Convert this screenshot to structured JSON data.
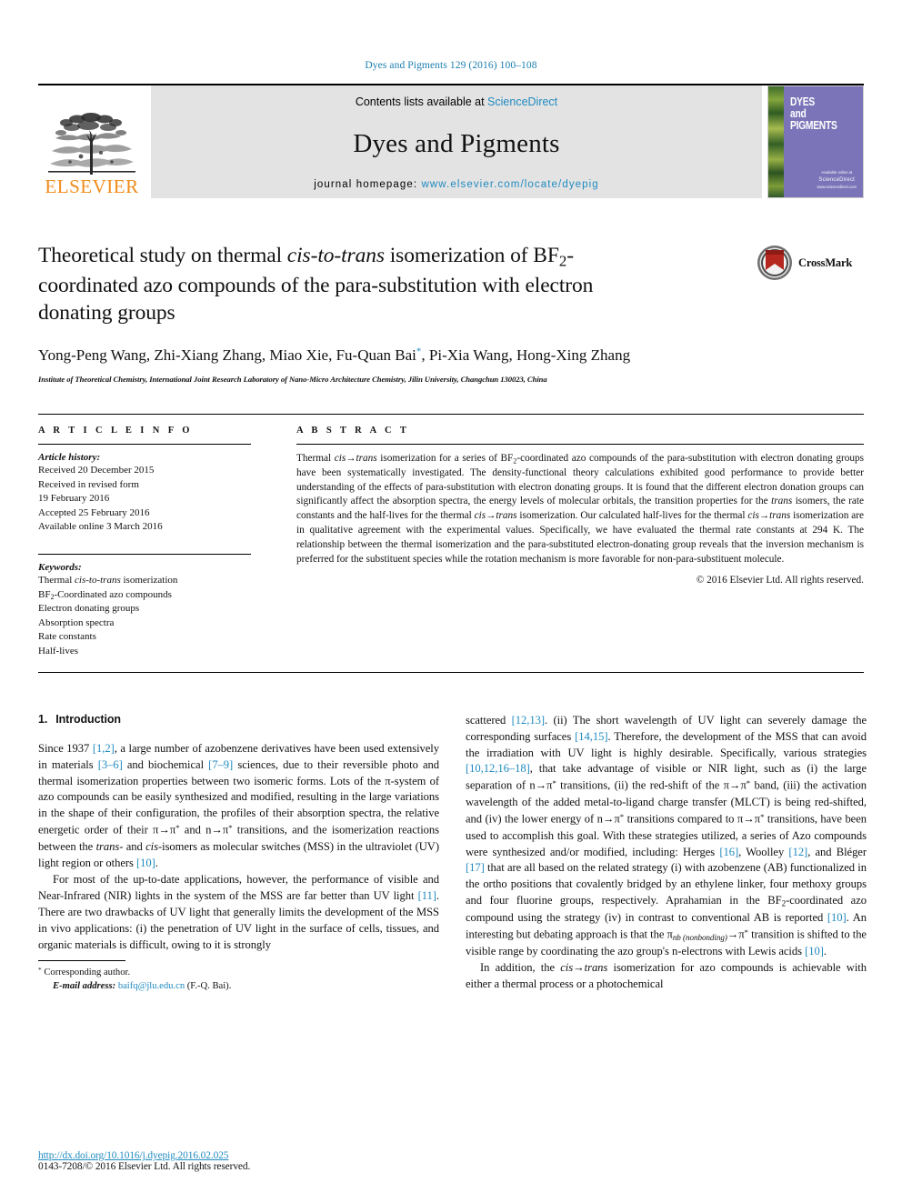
{
  "running_head": "Dyes and Pigments 129 (2016) 100–108",
  "masthead": {
    "publisher_wordmark": "ELSEVIER",
    "contents_prefix": "Contents lists available at ",
    "contents_link": "ScienceDirect",
    "journal_name": "Dyes and Pigments",
    "homepage_prefix": "journal homepage: ",
    "homepage_url": "www.elsevier.com/locate/dyepig",
    "cover": {
      "line1": "DYES",
      "line2": "and",
      "line3": "PIGMENTS",
      "footer_small": "Available online at",
      "footer_brand": "ScienceDirect",
      "footer_sub": "www.sciencedirect.com"
    }
  },
  "article": {
    "title_line1_a": "Theoretical study on thermal ",
    "title_line1_i": "cis-to-trans",
    "title_line1_b": " isomerization of",
    "title_line2_a": "BF",
    "title_line2_sub": "2",
    "title_line2_b": "-coordinated azo compounds of the para-substitution with",
    "title_line3": "electron donating groups",
    "crossmark_label": "CrossMark",
    "authors_line1": "Yong-Peng Wang, Zhi-Xiang Zhang, Miao Xie, Fu-Quan Bai",
    "authors_star": "*",
    "authors_line1_cont": ", Pi-Xia Wang,",
    "authors_line2": "Hong-Xing Zhang",
    "affiliation": "Institute of Theoretical Chemistry, International Joint Research Laboratory of Nano-Micro Architecture Chemistry, Jilin University, Changchun 130023, China"
  },
  "info": {
    "heading": "A R T I C L E  I N F O",
    "history_label": "Article history:",
    "history": [
      "Received 20 December 2015",
      "Received in revised form",
      "19 February 2016",
      "Accepted 25 February 2016",
      "Available online 3 March 2016"
    ],
    "keywords_label": "Keywords:",
    "keywords_plain": [
      "Electron donating groups",
      "Absorption spectra",
      "Rate constants",
      "Half-lives"
    ],
    "keyword_thermal_a": "Thermal ",
    "keyword_thermal_i": "cis-to-trans",
    "keyword_thermal_b": " isomerization",
    "keyword_bf2_a": "BF",
    "keyword_bf2_sub": "2",
    "keyword_bf2_b": "-Coordinated azo compounds"
  },
  "abstract": {
    "heading": "A B S T R A C T",
    "p1_a": "Thermal ",
    "p1_cis": "cis",
    "p1_arrow": "→",
    "p1_trans": "trans",
    "p1_b": " isomerization for a series of BF",
    "p1_sub": "2",
    "p1_c": "-coordinated azo compounds of the para-substitution with electron donating groups have been systematically investigated. The density-functional theory calculations exhibited good performance to provide better understanding of the effects of para-substitution with electron donating groups. It is found that the different electron donation groups can significantly affect the absorption spectra, the energy levels of molecular orbitals, the transition properties for the ",
    "p1_trans2": "trans",
    "p1_d": " isomers, the rate constants and the half-lives for the thermal ",
    "p1_e": " isomerization. Our calculated half-lives for the thermal ",
    "p1_f": " isomerization are in qualitative agreement with the experimental values. Specifically, we have evaluated the thermal rate constants at 294 K. The relationship between the thermal isomerization and the para-substituted electron-donating group reveals that the inversion mechanism is preferred for the substituent species while the rotation mechanism is more favorable for non-para-substituent molecule.",
    "copyright": "© 2016 Elsevier Ltd. All rights reserved."
  },
  "body": {
    "section_number": "1.",
    "section_title": "Introduction",
    "left": {
      "p1_s1": "Since 1937 ",
      "p1_r1": "[1,2]",
      "p1_s2": ", a large number of azobenzene derivatives have been used extensively in materials ",
      "p1_r2": "[3–6]",
      "p1_s3": " and biochemical ",
      "p1_r3": "[7–9]",
      "p1_s4": " sciences, due to their reversible photo and thermal isomerization properties between two isomeric forms. Lots of the π-system of azo compounds can be easily synthesized and modified, resulting in the large variations in the shape of their configuration, the profiles of their absorption spectra, the relative energetic order of their π→π",
      "p1_s5": " and n→π",
      "p1_s6": " transitions, and the isomerization reactions between the ",
      "p1_i1": "trans-",
      "p1_s7": " and ",
      "p1_i2": "cis",
      "p1_s8": "-isomers as molecular switches (MSS) in the ultraviolet (UV) light region or others ",
      "p1_r4": "[10]",
      "p1_s9": ".",
      "p2_s1": "For most of the up-to-date applications, however, the performance of visible and Near-Infrared (NIR) lights in the system of the MSS are far better than UV light ",
      "p2_r1": "[11]",
      "p2_s2": ". There are two drawbacks of UV light that generally limits the development of the MSS in vivo applications: (i) the penetration of UV light in the surface of cells, tissues, and organic materials is difficult, owing to it is strongly"
    },
    "right": {
      "p1_s1": "scattered ",
      "p1_r1": "[12,13]",
      "p1_s2": ". (ii) The short wavelength of UV light can severely damage the corresponding surfaces ",
      "p1_r2": "[14,15]",
      "p1_s3": ". Therefore, the development of the MSS that can avoid the irradiation with UV light is highly desirable. Specifically, various strategies ",
      "p1_r3": "[10,12,16–18]",
      "p1_s4": ", that take advantage of visible or NIR light, such as (i) the large separation of n→π",
      "p1_s5": " transitions, (ii) the red-shift of the π→π",
      "p1_s6": " band, (iii) the activation wavelength of the added metal-to-ligand charge transfer (MLCT) is being red-shifted, and (iv) the lower energy of n→π",
      "p1_s7": " transitions compared to π→π",
      "p1_s8": " transitions, have been used to accomplish this goal. With these strategies utilized, a series of Azo compounds were synthesized and/or modified, including: Herges ",
      "p1_r4": "[16]",
      "p1_s9": ", Woolley ",
      "p1_r5": "[12]",
      "p1_s10": ", and Bléger ",
      "p1_r6": "[17]",
      "p1_s11": " that are all based on the related strategy (i) with azobenzene (AB) functionalized in the ortho positions that covalently bridged by an ethylene linker, four methoxy groups and four fluorine groups, respectively. Aprahamian in the BF",
      "p1_sub": "2",
      "p1_s12": "-coordinated azo compound using the strategy (iv) in contrast to conventional AB is reported ",
      "p1_r7": "[10]",
      "p1_s13": ". An interesting but debating approach is that the π",
      "p1_nb": "nb (nonbonding)",
      "p1_s14": "→π",
      "p1_s15": " transition is shifted to the visible range by coordinating the azo group's n-electrons with Lewis acids ",
      "p1_r8": "[10]",
      "p1_s16": ".",
      "p2_s1": "In addition, the ",
      "p2_cis": "cis",
      "p2_arrow": "→",
      "p2_trans": "trans",
      "p2_s2": " isomerization for azo compounds is achievable with either a thermal process or a photochemical"
    }
  },
  "footnote": {
    "star": "*",
    "corresponding": " Corresponding author.",
    "email_label": "E-mail address:",
    "email": "baifq@jlu.edu.cn",
    "email_suffix": " (F.-Q. Bai)."
  },
  "pagefoot": {
    "doi": "http://dx.doi.org/10.1016/j.dyepig.2016.02.025",
    "issn": "0143-7208/© 2016 Elsevier Ltd. All rights reserved."
  },
  "colors": {
    "link": "#1f8ac0",
    "elsevier_orange": "#f08c1b",
    "cover_purple": "#7b74b8"
  }
}
